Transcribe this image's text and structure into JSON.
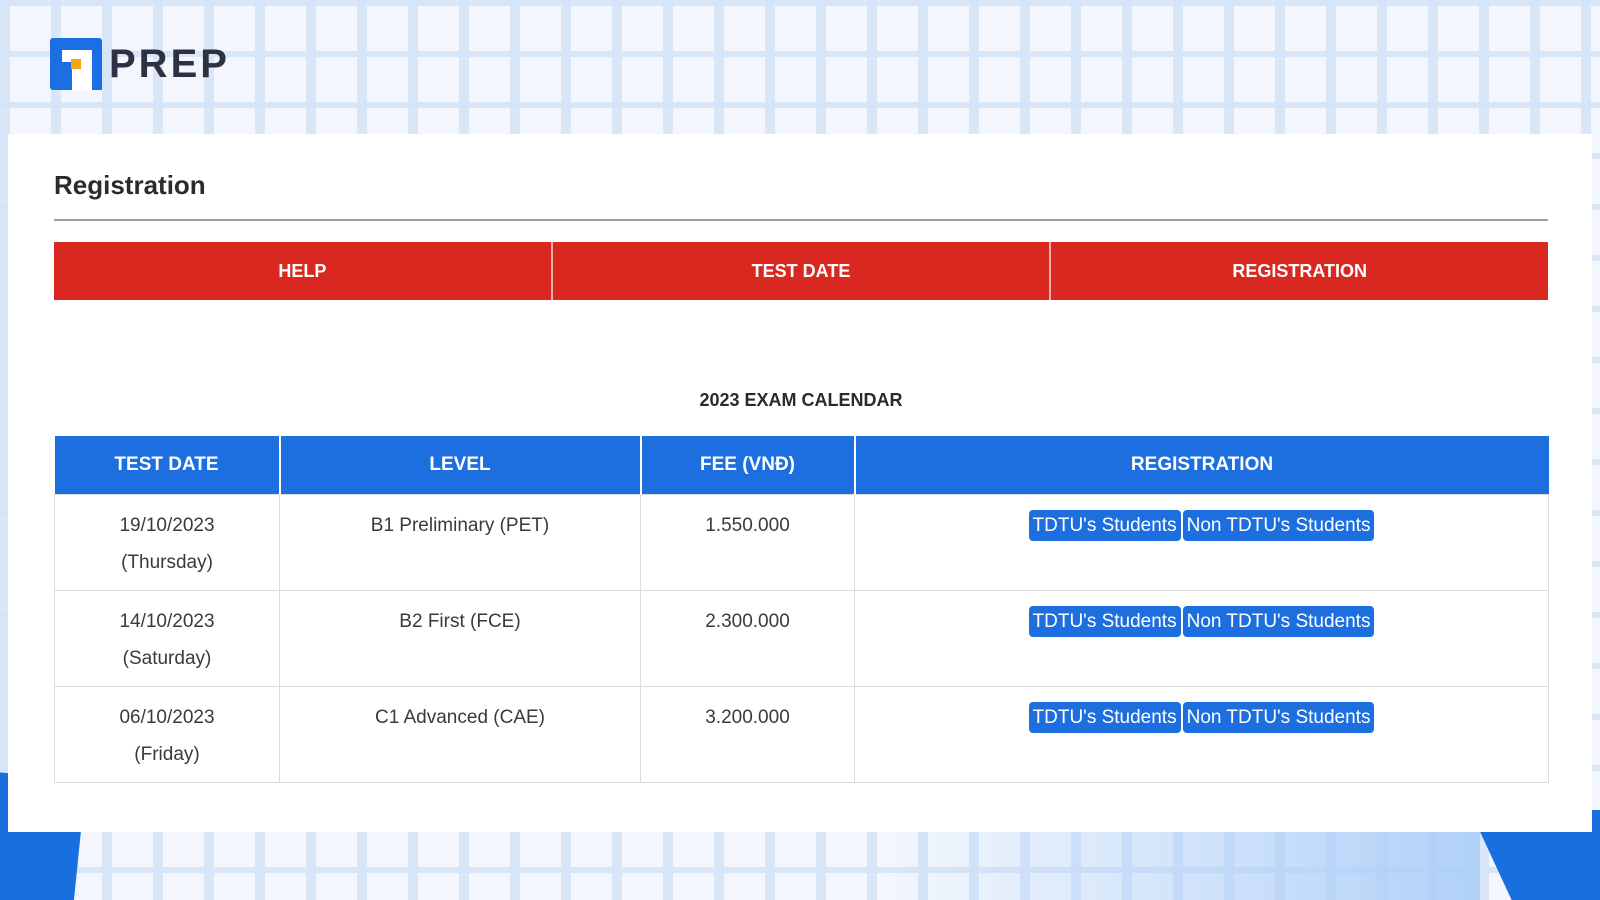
{
  "brand": {
    "name": "PREP"
  },
  "section": {
    "title": "Registration"
  },
  "tabs": [
    {
      "label": "HELP"
    },
    {
      "label": "TEST DATE"
    },
    {
      "label": "REGISTRATION"
    }
  ],
  "calendar": {
    "title": "2023 EXAM CALENDAR",
    "columns": [
      "TEST DATE",
      "LEVEL",
      "FEE (VNĐ)",
      "REGISTRATION"
    ],
    "rows": [
      {
        "date": "19/10/2023",
        "weekday": "(Thursday)",
        "level": "B1 Preliminary (PET)",
        "fee": "1.550.000",
        "btn_a": "TDTU's Students",
        "btn_b": "Non TDTU's Students"
      },
      {
        "date": "14/10/2023",
        "weekday": "(Saturday)",
        "level": "B2 First (FCE)",
        "fee": "2.300.000",
        "btn_a": "TDTU's Students",
        "btn_b": "Non TDTU's Students"
      },
      {
        "date": "06/10/2023",
        "weekday": "(Friday)",
        "level": "C1 Advanced (CAE)",
        "fee": "3.200.000",
        "btn_a": "TDTU's Students",
        "btn_b": "Non TDTU's Students"
      }
    ]
  },
  "colors": {
    "tab_bar": "#d8281f",
    "table_header": "#1d6fe0",
    "button": "#1d6fe0",
    "brand_blue": "#1b6fe3",
    "brand_orange": "#f6a21a"
  },
  "icons": {
    "logo": "prep-logo-icon"
  }
}
